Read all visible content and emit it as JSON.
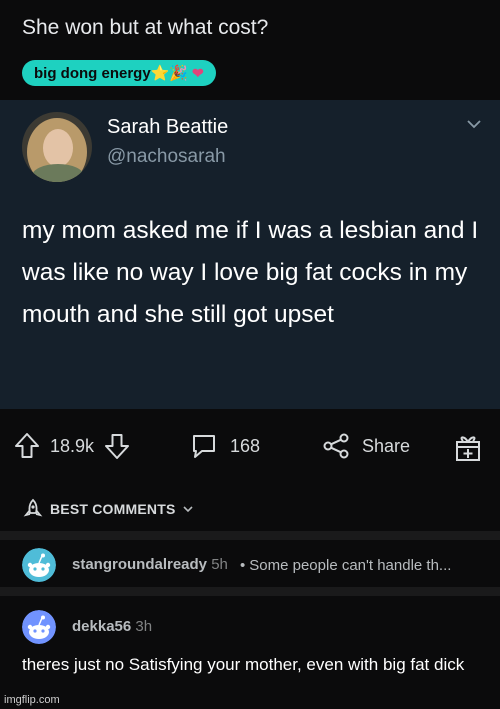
{
  "post": {
    "title": "She won but at what cost?",
    "flair": "big dong energy⭐🎉",
    "flair_heart": "❤"
  },
  "tweet": {
    "name": "Sarah Beattie",
    "handle": "@nachosarah",
    "text": "my mom asked me if I was a lesbian and I was like no way I love big fat cocks in my mouth and she still got upset"
  },
  "actions": {
    "upvotes": "18.9k",
    "comments": "168",
    "share": "Share"
  },
  "comments_header": "BEST COMMENTS",
  "comments": [
    {
      "user": "stangroundalready",
      "time": "5h",
      "preview": "Some people can't handle th..."
    },
    {
      "user": "dekka56",
      "time": "3h",
      "body": "theres just  no Satisfying your mother, even with big fat dick"
    }
  ],
  "watermark": "imgflip.com",
  "colors": {
    "flair": "#1ed1c0",
    "tweet_bg": "#15202b",
    "page_bg": "#0b0b0c"
  }
}
